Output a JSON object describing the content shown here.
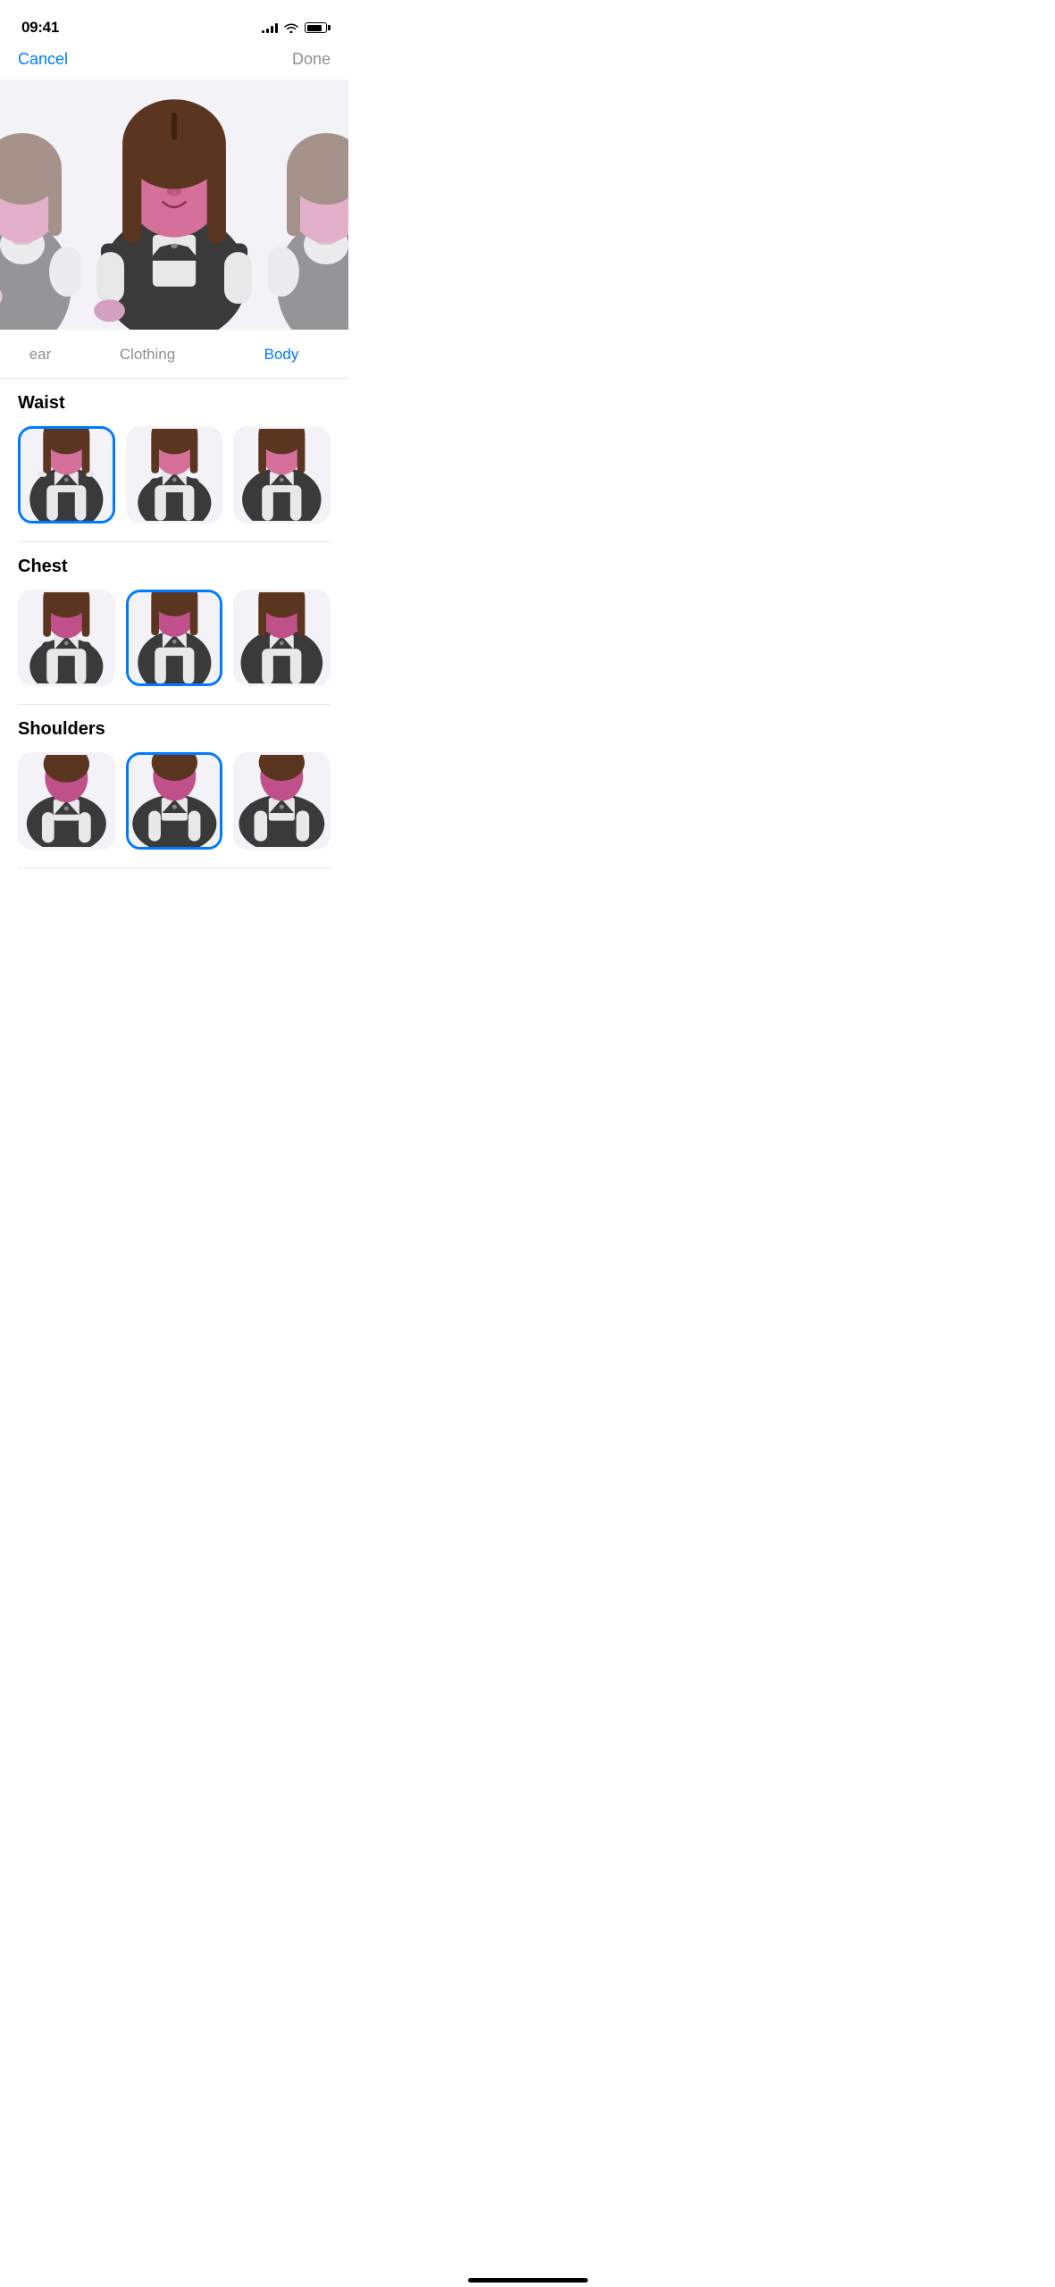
{
  "status_bar": {
    "time": "09:41",
    "signal_bars": 4,
    "wifi": true,
    "battery_pct": 80
  },
  "nav": {
    "cancel_label": "Cancel",
    "done_label": "Done"
  },
  "tabs": [
    {
      "id": "headwear",
      "label": "ear",
      "active": false,
      "partial": true
    },
    {
      "id": "clothing",
      "label": "Clothing",
      "active": false
    },
    {
      "id": "body",
      "label": "Body",
      "active": true
    }
  ],
  "sections": [
    {
      "id": "waist",
      "title": "Waist",
      "options": [
        {
          "id": "w1",
          "selected": true
        },
        {
          "id": "w2",
          "selected": false
        },
        {
          "id": "w3",
          "selected": false
        }
      ]
    },
    {
      "id": "chest",
      "title": "Chest",
      "options": [
        {
          "id": "c1",
          "selected": false
        },
        {
          "id": "c2",
          "selected": true
        },
        {
          "id": "c3",
          "selected": false
        }
      ]
    },
    {
      "id": "shoulders",
      "title": "Shoulders",
      "options": [
        {
          "id": "s1",
          "selected": false
        },
        {
          "id": "s2",
          "selected": true
        },
        {
          "id": "s3",
          "selected": false
        }
      ]
    }
  ],
  "home_indicator": true
}
